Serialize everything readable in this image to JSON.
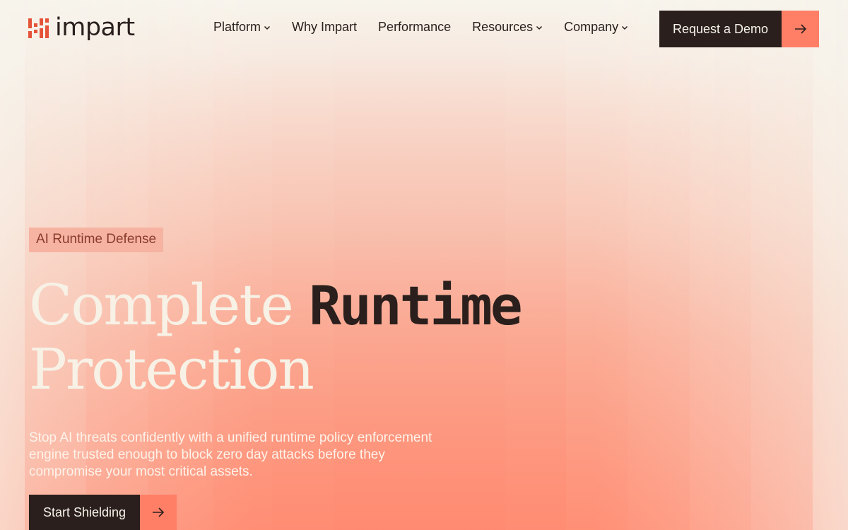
{
  "header": {
    "logo_text": "impart",
    "nav": [
      {
        "label": "Platform",
        "has_dropdown": true
      },
      {
        "label": "Why Impart",
        "has_dropdown": false
      },
      {
        "label": "Performance",
        "has_dropdown": false
      },
      {
        "label": "Resources",
        "has_dropdown": true
      },
      {
        "label": "Company",
        "has_dropdown": true
      }
    ],
    "demo_label": "Request a Demo"
  },
  "hero": {
    "badge": "AI Runtime Defense",
    "headline_part1": "Complete ",
    "headline_part2": "Runtime",
    "headline_part3": "Protection",
    "subtitle": "Stop AI threats confidently with a unified runtime policy enforcement engine trusted enough to block zero day attacks before they compromise your most critical assets.",
    "cta_label": "Start Shielding"
  },
  "colors": {
    "accent": "#ff7f66",
    "dark": "#2a1f1c",
    "background": "#f7f4ec",
    "logo": "#e5533a"
  },
  "icons": {
    "chevron": "chevron-down-icon",
    "arrow": "arrow-right-icon",
    "logo": "impart-logo-icon"
  }
}
